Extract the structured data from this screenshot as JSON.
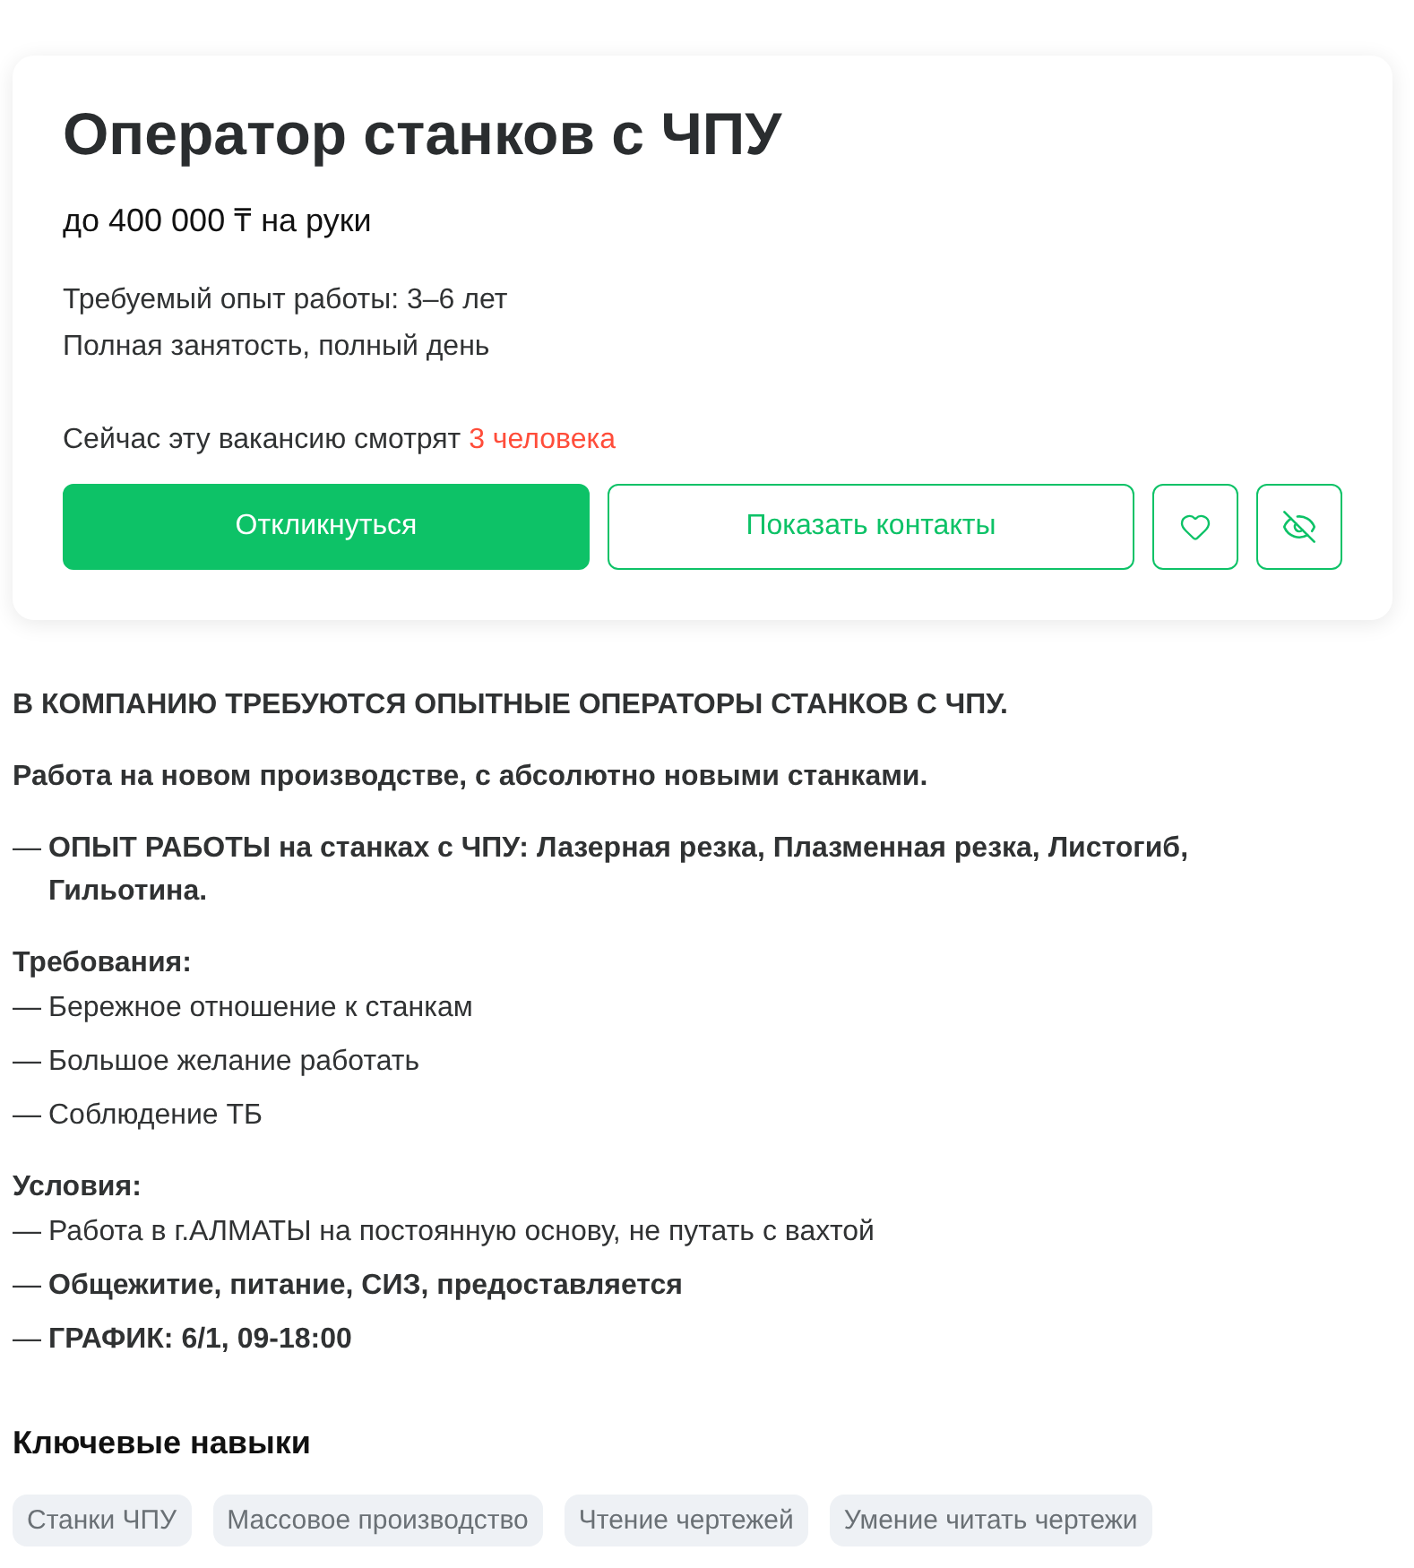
{
  "vacancy": {
    "title": "Оператор станков с ЧПУ",
    "salary": "до 400 000 ₸ на руки",
    "details": [
      "Требуемый опыт работы: 3–6 лет",
      "Полная занятость, полный день"
    ],
    "viewers": {
      "text": "Сейчас эту вакансию смотрят",
      "highlight": "3 человека"
    },
    "buttons": [
      {
        "kind": "primary",
        "label": "Откликнуться"
      },
      {
        "kind": "outline",
        "label": "Показать контакты"
      }
    ]
  },
  "description": [
    {
      "kind": "paragraph",
      "text": "В КОМПАНИЮ ТРЕБУЮТСЯ ОПЫТНЫЕ ОПЕРАТОРЫ СТАНКОВ С ЧПУ.",
      "bold": true
    },
    {
      "kind": "paragraph",
      "text": "Работа на новом производстве, с абсолютно новыми станками.",
      "bold": true
    },
    {
      "kind": "bullet",
      "marker": "—",
      "text": "ОПЫТ РАБОТЫ на станках с ЧПУ: Лазерная резка, Плазменная резка, Листогиб, Гильотина.",
      "bold": true
    },
    {
      "kind": "section",
      "title": "Требования:",
      "items": [
        {
          "marker": "—",
          "text": "Бережное отношение к станкам",
          "bold": false
        },
        {
          "marker": "—",
          "text": "Большое желание работать",
          "bold": false
        },
        {
          "marker": "—",
          "text": "Соблюдение ТБ",
          "bold": false
        }
      ]
    },
    {
      "kind": "section",
      "title": "Условия:",
      "items": [
        {
          "marker": "—",
          "text": "Работа в г.АЛМАТЫ на постоянную основу, не путать с вахтой",
          "bold": false
        },
        {
          "marker": "—",
          "text": "Общежитие, питание, СИЗ, предоставляется",
          "bold": true
        },
        {
          "marker": "—",
          "text": "ГРАФИК: 6/1, 09-18:00",
          "bold": true
        }
      ]
    }
  ],
  "skills": {
    "title": "Ключевые навыки",
    "tags": [
      "Станки ЧПУ",
      "Массовое производство",
      "Чтение чертежей",
      "Умение читать чертежи"
    ]
  }
}
